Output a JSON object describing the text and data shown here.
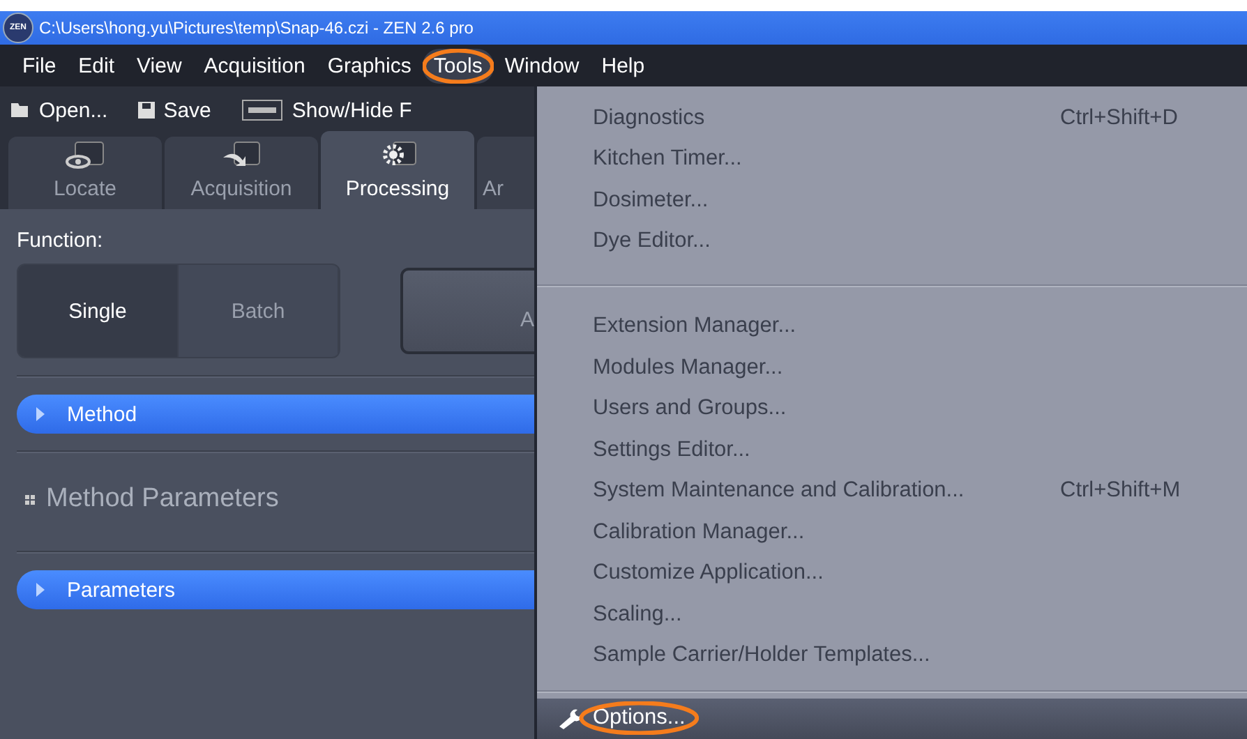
{
  "window": {
    "title": "C:\\Users\\hong.yu\\Pictures\\temp\\Snap-46.czi - ZEN 2.6 pro",
    "logo": "ZEN"
  },
  "menu_bar": [
    {
      "label": "File",
      "selected": false,
      "highlighted": false
    },
    {
      "label": "Edit",
      "selected": false,
      "highlighted": false
    },
    {
      "label": "View",
      "selected": false,
      "highlighted": false
    },
    {
      "label": "Acquisition",
      "selected": false,
      "highlighted": false
    },
    {
      "label": "Graphics",
      "selected": false,
      "highlighted": false
    },
    {
      "label": "Tools",
      "selected": true,
      "highlighted": true
    },
    {
      "label": "Window",
      "selected": false,
      "highlighted": false
    },
    {
      "label": "Help",
      "selected": false,
      "highlighted": false
    }
  ],
  "toolbar": [
    {
      "label": "Open...",
      "kind": "folder"
    },
    {
      "label": "Save",
      "kind": "disk"
    },
    {
      "label": "Show/Hide F",
      "kind": "ruler"
    }
  ],
  "tabs": [
    {
      "label": "Locate",
      "selected": false,
      "kind": "eye"
    },
    {
      "label": "Acquisition",
      "selected": false,
      "kind": "arrow"
    },
    {
      "label": "Processing",
      "selected": true,
      "kind": "gear"
    },
    {
      "label": "Ar",
      "selected": false,
      "kind": "none"
    }
  ],
  "panel": {
    "function_label": "Function:",
    "function_modes": [
      {
        "label": "Single",
        "selected": true
      },
      {
        "label": "Batch",
        "selected": false
      }
    ],
    "action_button": "A",
    "sections": [
      {
        "kind": "bar",
        "label": "Method",
        "expanded": false
      },
      {
        "kind": "heading",
        "label": "Method Parameters"
      },
      {
        "kind": "bar",
        "label": "Parameters",
        "expanded": false
      }
    ]
  },
  "tools_menu": {
    "groups": [
      [
        {
          "label": "Diagnostics",
          "shortcut": "Ctrl+Shift+D"
        },
        {
          "label": "Kitchen Timer..."
        },
        {
          "label": "Dosimeter..."
        },
        {
          "label": "Dye Editor..."
        }
      ],
      [
        {
          "label": "Extension Manager..."
        },
        {
          "label": "Modules Manager..."
        },
        {
          "label": "Users and Groups..."
        },
        {
          "label": "Settings Editor..."
        },
        {
          "label": "System Maintenance and Calibration...",
          "shortcut": "Ctrl+Shift+M"
        },
        {
          "label": "Calibration Manager..."
        },
        {
          "label": "Customize Application..."
        },
        {
          "label": "Scaling..."
        },
        {
          "label": "Sample Carrier/Holder Templates..."
        }
      ],
      [
        {
          "label": "Options...",
          "kind": "settings",
          "selected": true,
          "highlighted": true
        }
      ]
    ]
  }
}
